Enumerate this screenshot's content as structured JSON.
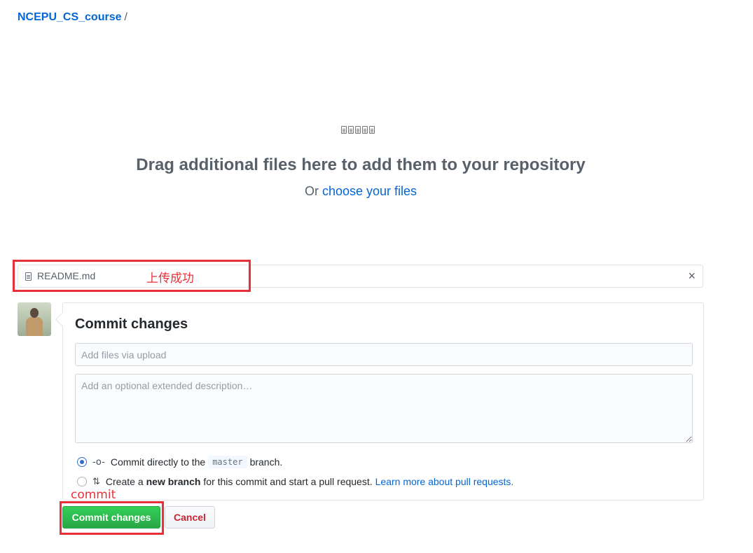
{
  "breadcrumb": {
    "repo": "NCEPU_CS_course",
    "separator": "/"
  },
  "dropzone": {
    "icons": [
      "file-icon",
      "file-chart-icon",
      "file-code-icon",
      "file-text-icon",
      "file-pdf-icon"
    ],
    "title": "Drag additional files here to add them to your repository",
    "prefix": "Or",
    "link": "choose your files"
  },
  "uploaded_file": {
    "name": "README.md",
    "remove_symbol": "×"
  },
  "annotations": {
    "upload_success": "上传成功",
    "commit": "commit",
    "color": "#e8303a"
  },
  "commit": {
    "title": "Commit changes",
    "summary_placeholder": "Add files via upload",
    "description_placeholder": "Add an optional extended description…",
    "option_direct": {
      "prefix": "Commit directly to the",
      "branch": "master",
      "suffix": "branch.",
      "selected": true
    },
    "option_new": {
      "prefix": "Create a",
      "bold": "new branch",
      "suffix": "for this commit and start a pull request.",
      "link": "Learn more about pull requests.",
      "selected": false
    },
    "submit_label": "Commit changes",
    "cancel_label": "Cancel"
  },
  "colors": {
    "link": "#0366d6",
    "primary_button": "#28a745",
    "danger_text": "#cb2431"
  }
}
